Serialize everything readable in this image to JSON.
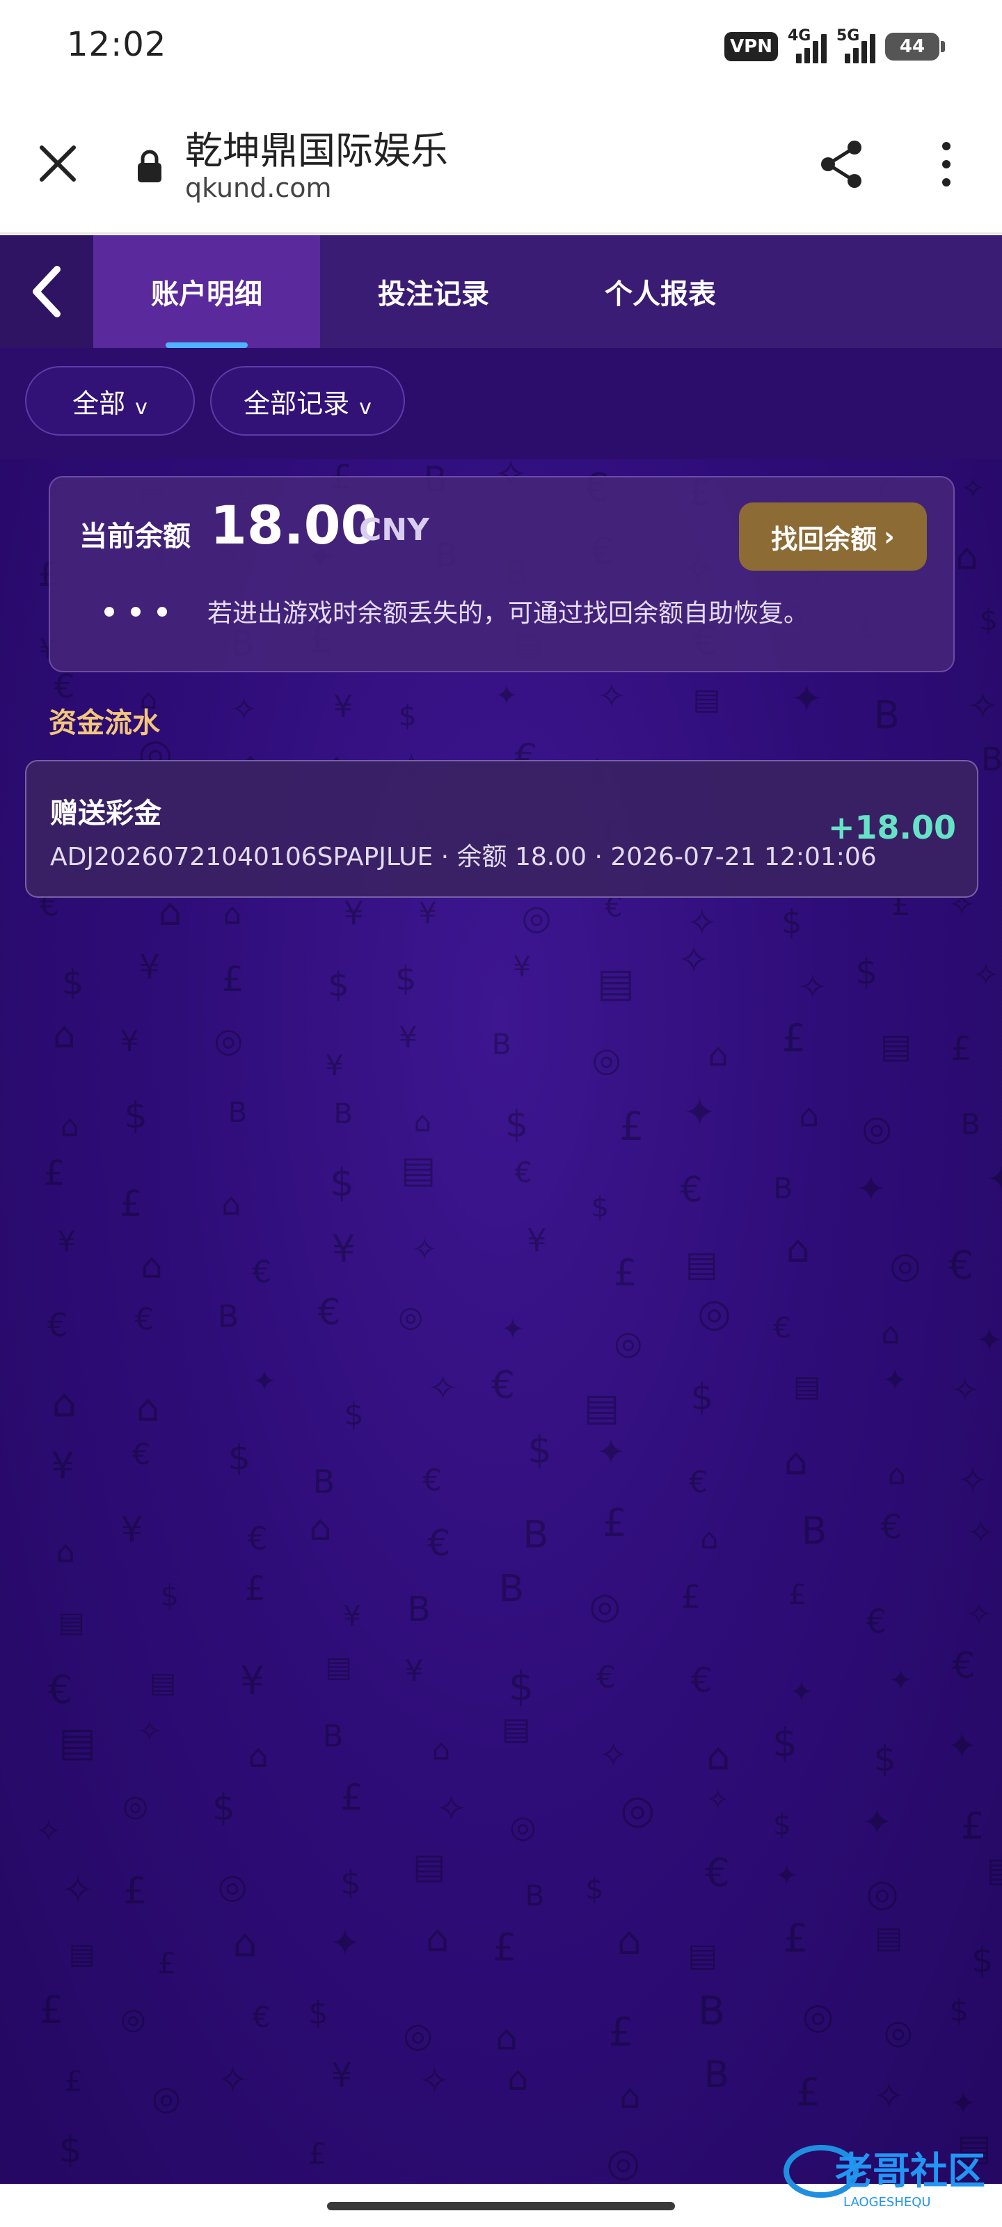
{
  "status_bar": {
    "time": "12:02",
    "vpn": "VPN",
    "net1": "4G",
    "net2": "5G",
    "battery": "44"
  },
  "browser": {
    "title": "乾坤鼎国际娱乐",
    "url": "qkund.com"
  },
  "tabs": [
    {
      "label": "账户明细",
      "active": true
    },
    {
      "label": "投注记录",
      "active": false
    },
    {
      "label": "个人报表",
      "active": false
    }
  ],
  "filters": {
    "type": "全部",
    "records": "全部记录"
  },
  "balance": {
    "label": "当前余额",
    "amount": "18.00",
    "currency": "CNY",
    "recover_button": "找回余额",
    "hint": "若进出游戏时余额丢失的，可通过找回余额自助恢复。"
  },
  "section": {
    "title": "资金流水"
  },
  "transactions": [
    {
      "title": "赠送彩金",
      "detail": "ADJ20260721040106SPAPJLUE · 余额 18.00 · 2026-07-21 12:01:06",
      "amount": "+18.00"
    }
  ],
  "colors": {
    "background": "#2f0d79",
    "tab_active": "#5a2a9c",
    "accent_gold": "#8c6b35",
    "section_title": "#f2c77a",
    "positive_amount": "#66e3c6"
  },
  "watermark": {
    "text": "老哥社区",
    "subtext": "LAOGESHEQU"
  }
}
